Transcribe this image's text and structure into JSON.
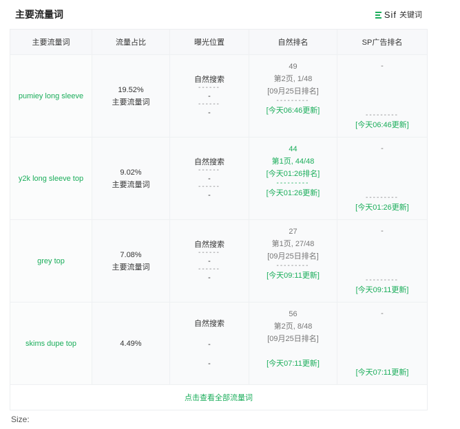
{
  "header": {
    "title": "主要流量词",
    "sif_brand": "Sif",
    "sif_label": "关键词"
  },
  "table": {
    "columns": [
      "主要流量词",
      "流量占比",
      "曝光位置",
      "自然排名",
      "SP广告排名"
    ],
    "rows": [
      {
        "keyword": "pumiey long sleeve",
        "percent": "19.52%",
        "percent_tag": "主要流量词",
        "exposure": "自然搜索",
        "exposure_a": "-",
        "exposure_b": "-",
        "rank_value": "49",
        "rank_page": "第2页, 1/48",
        "rank_date": "[09月25日排名]",
        "rank_update": "[今天06:46更新]",
        "sp_value": "-",
        "sp_update": "[今天06:46更新]"
      },
      {
        "keyword": "y2k long sleeve top",
        "percent": "9.02%",
        "percent_tag": "主要流量词",
        "exposure": "自然搜索",
        "exposure_a": "-",
        "exposure_b": "-",
        "rank_value": "44",
        "rank_page": "第1页, 44/48",
        "rank_date": "[今天01:26排名]",
        "rank_update": "[今天01:26更新]",
        "sp_value": "-",
        "sp_update": "[今天01:26更新]"
      },
      {
        "keyword": "grey top",
        "percent": "7.08%",
        "percent_tag": "主要流量词",
        "exposure": "自然搜索",
        "exposure_a": "-",
        "exposure_b": "-",
        "rank_value": "27",
        "rank_page": "第1页, 27/48",
        "rank_date": "[09月25日排名]",
        "rank_update": "[今天09:11更新]",
        "sp_value": "-",
        "sp_update": "[今天09:11更新]"
      },
      {
        "keyword": "skims dupe top",
        "percent": "4.49%",
        "percent_tag": "",
        "exposure": "自然搜索",
        "exposure_a": "-",
        "exposure_b": "-",
        "rank_value": "56",
        "rank_page": "第2页, 8/48",
        "rank_date": "[09月25日排名]",
        "rank_update": "[今天07:11更新]",
        "sp_value": "-",
        "sp_update": "[今天07:11更新]"
      }
    ],
    "footer_link": "点击查看全部流量词"
  },
  "size_label": "Size:",
  "colors": {
    "accent": "#1aad5a",
    "header_bg": "#f7f8fa",
    "row_bg": "#f9fafb"
  }
}
